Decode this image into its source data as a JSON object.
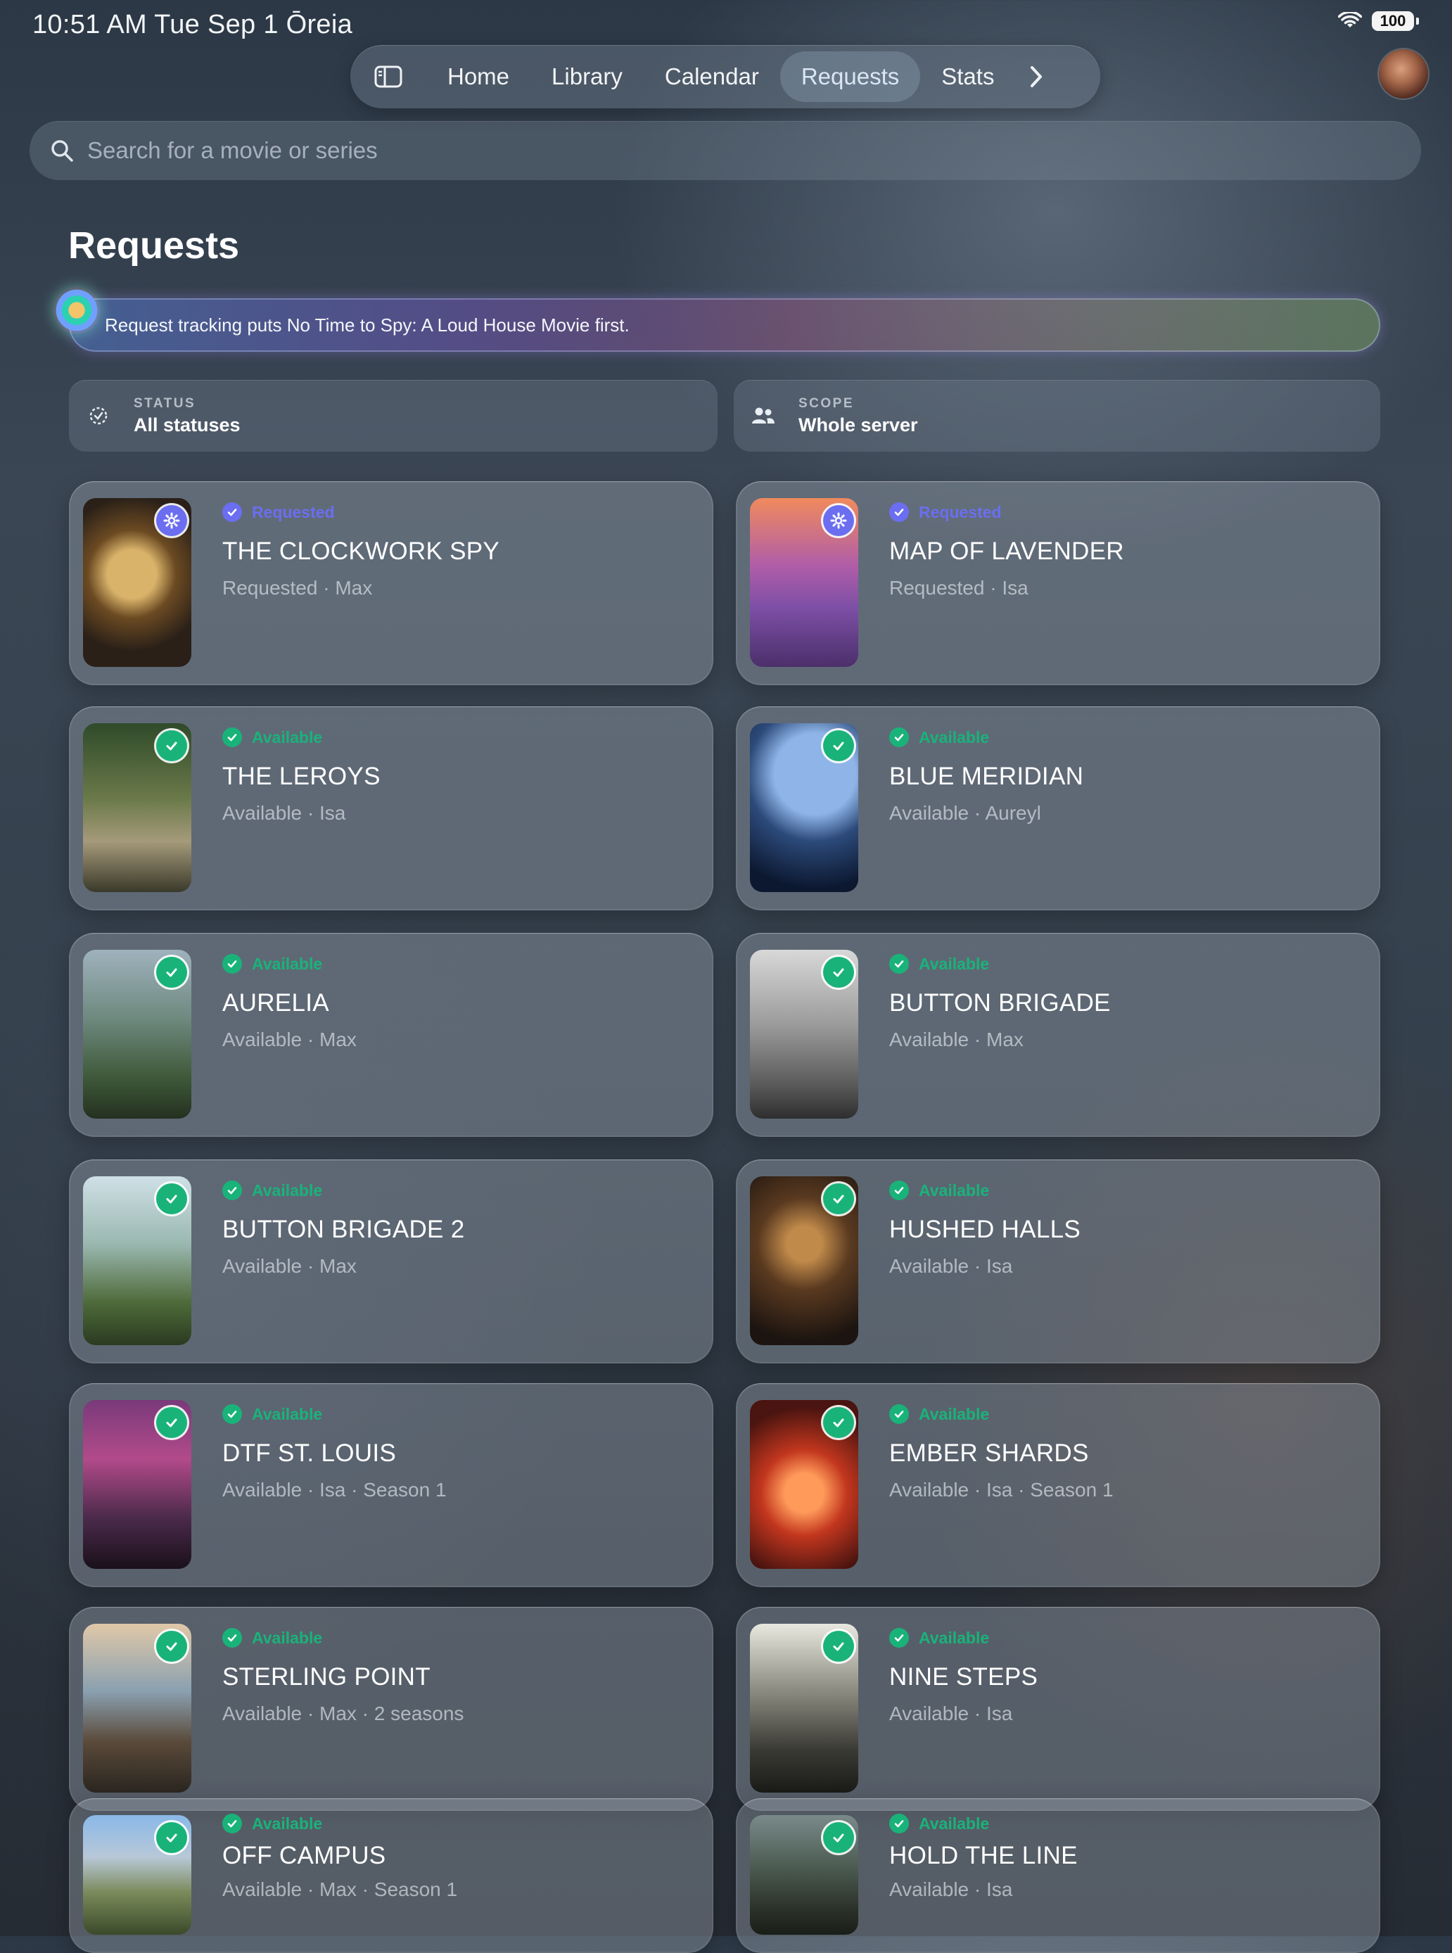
{
  "status_bar": {
    "time": "10:51 AM  Tue Sep 1  Ōreia",
    "battery": "100"
  },
  "nav": {
    "tabs": [
      "Home",
      "Library",
      "Calendar",
      "Requests",
      "Stats"
    ],
    "active_tab": "Requests"
  },
  "search": {
    "placeholder": "Search for a movie or series"
  },
  "page": {
    "title": "Requests"
  },
  "insight": {
    "text": "Request tracking puts No Time to Spy: A Loud House Movie first."
  },
  "filters": {
    "status": {
      "label": "STATUS",
      "value": "All statuses"
    },
    "scope": {
      "label": "SCOPE",
      "value": "Whole server"
    }
  },
  "colors": {
    "available": "#19b37a",
    "requested": "#6b6ef0"
  },
  "requests": [
    {
      "status": "Requested",
      "title": "THE CLOCKWORK SPY",
      "subtitle": "Requested · Max"
    },
    {
      "status": "Requested",
      "title": "MAP OF LAVENDER",
      "subtitle": "Requested · Isa"
    },
    {
      "status": "Available",
      "title": "THE LEROYS",
      "subtitle": "Available · Isa"
    },
    {
      "status": "Available",
      "title": "BLUE MERIDIAN",
      "subtitle": "Available · Aureyl"
    },
    {
      "status": "Available",
      "title": "AURELIA",
      "subtitle": "Available · Max"
    },
    {
      "status": "Available",
      "title": "BUTTON BRIGADE",
      "subtitle": "Available · Max"
    },
    {
      "status": "Available",
      "title": "BUTTON BRIGADE 2",
      "subtitle": "Available · Max"
    },
    {
      "status": "Available",
      "title": "HUSHED HALLS",
      "subtitle": "Available · Isa"
    },
    {
      "status": "Available",
      "title": "DTF ST. LOUIS",
      "subtitle": "Available · Isa · Season 1"
    },
    {
      "status": "Available",
      "title": "EMBER SHARDS",
      "subtitle": "Available · Isa · Season 1"
    },
    {
      "status": "Available",
      "title": "STERLING POINT",
      "subtitle": "Available · Max · 2 seasons"
    },
    {
      "status": "Available",
      "title": "NINE STEPS",
      "subtitle": "Available · Isa"
    },
    {
      "status": "Available",
      "title": "OFF CAMPUS",
      "subtitle": "Available · Max · Season 1"
    },
    {
      "status": "Available",
      "title": "HOLD THE LINE",
      "subtitle": "Available · Isa"
    }
  ]
}
